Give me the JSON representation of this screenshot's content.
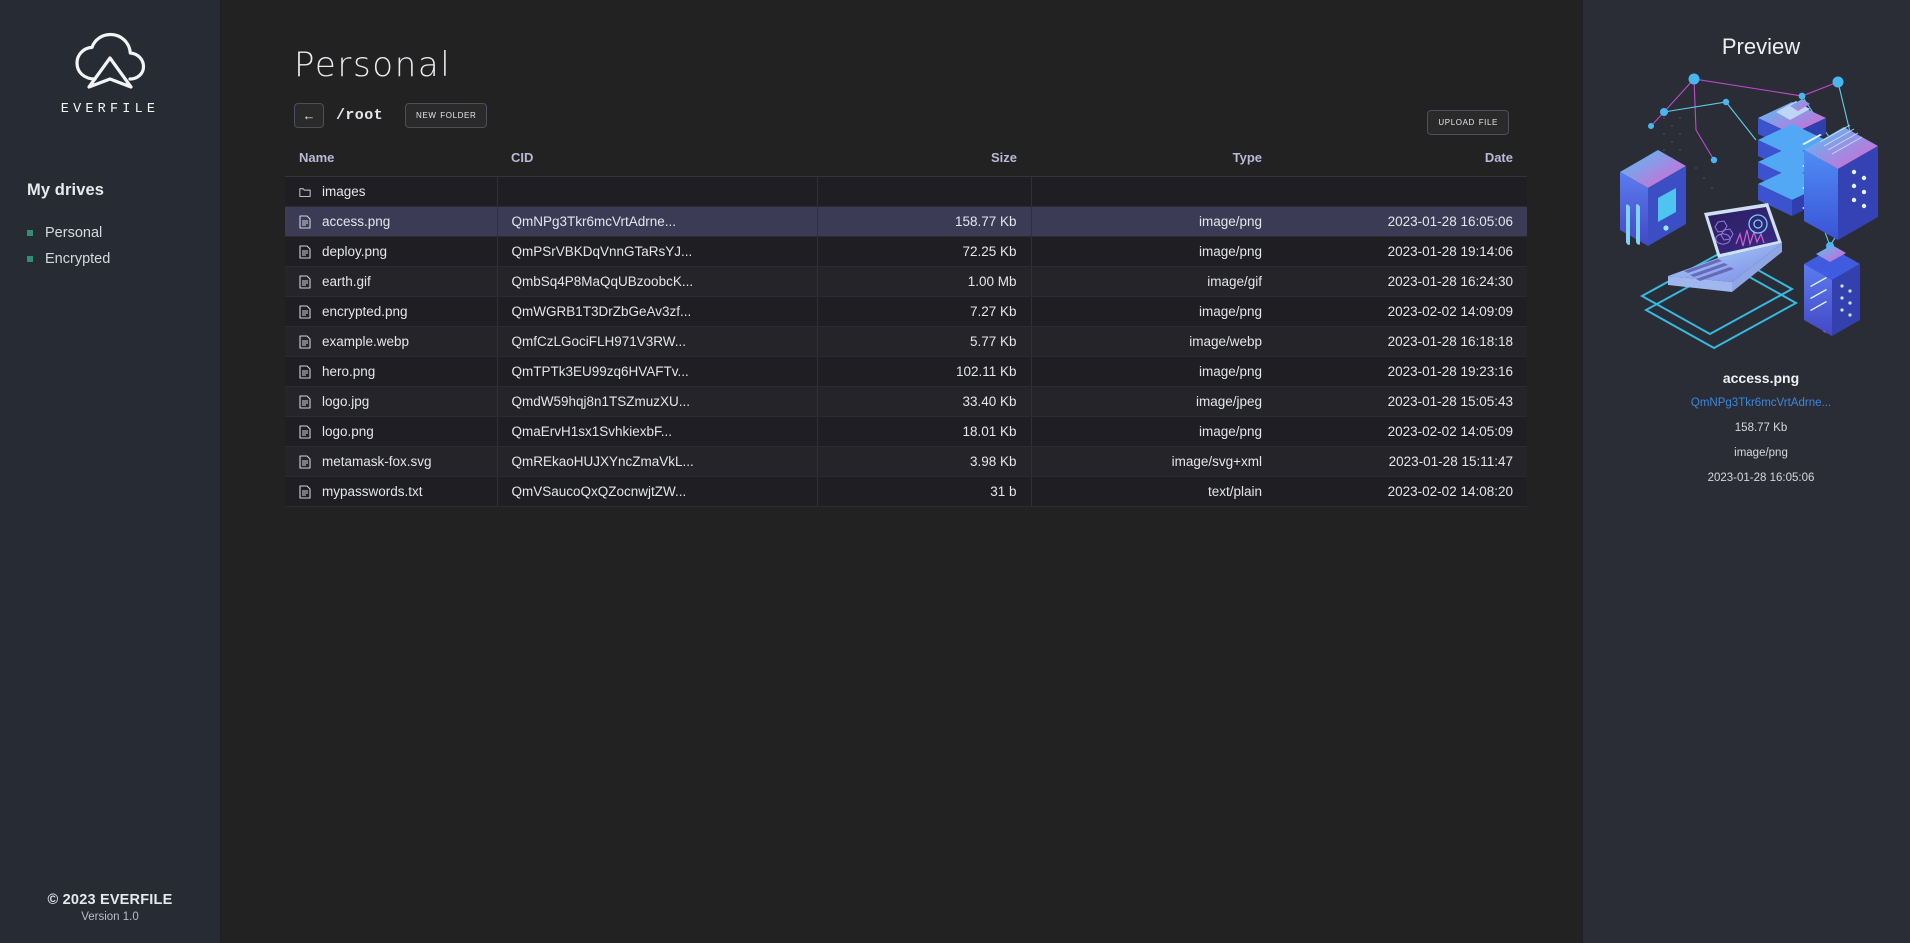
{
  "brand": {
    "name": "EVERFILE",
    "logo_icon": "cloud-upload-icon"
  },
  "sidebar": {
    "drives_heading": "My drives",
    "drives": [
      {
        "label": "Personal",
        "bullet_color": "#2f8f6f",
        "active": true
      },
      {
        "label": "Encrypted",
        "bullet_color": "#2f8f6f",
        "active": false
      }
    ],
    "footer": {
      "copyright": "© 2023 EVERFILE",
      "version": "Version 1.0"
    }
  },
  "main": {
    "page_title": "Personal",
    "toolbar": {
      "back_label": "←",
      "back_icon": "arrow-left-icon",
      "breadcrumb": "/root",
      "new_folder_label": "New Folder",
      "upload_label": "Upload File"
    },
    "table": {
      "columns": [
        "Name",
        "CID",
        "Size",
        "Type",
        "Date"
      ],
      "folders": [
        {
          "name": "images",
          "icon": "folder-icon"
        }
      ],
      "files": [
        {
          "name": "access.png",
          "icon": "file-icon",
          "cid": "QmNPg3Tkr6mcVrtAdrne...",
          "size": "158.77 Kb",
          "type": "image/png",
          "date": "2023-01-28 16:05:06",
          "selected": true
        },
        {
          "name": "deploy.png",
          "icon": "file-icon",
          "cid": "QmPSrVBKDqVnnGTaRsYJ...",
          "size": "72.25 Kb",
          "type": "image/png",
          "date": "2023-01-28 19:14:06",
          "selected": false
        },
        {
          "name": "earth.gif",
          "icon": "file-icon",
          "cid": "QmbSq4P8MaQqUBzoobcK...",
          "size": "1.00 Mb",
          "type": "image/gif",
          "date": "2023-01-28 16:24:30",
          "selected": false
        },
        {
          "name": "encrypted.png",
          "icon": "file-icon",
          "cid": "QmWGRB1T3DrZbGeAv3zf...",
          "size": "7.27 Kb",
          "type": "image/png",
          "date": "2023-02-02 14:09:09",
          "selected": false
        },
        {
          "name": "example.webp",
          "icon": "file-icon",
          "cid": "QmfCzLGociFLH971V3RW...",
          "size": "5.77 Kb",
          "type": "image/webp",
          "date": "2023-01-28 16:18:18",
          "selected": false
        },
        {
          "name": "hero.png",
          "icon": "file-icon",
          "cid": "QmTPTk3EU99zq6HVAFTv...",
          "size": "102.11 Kb",
          "type": "image/png",
          "date": "2023-01-28 19:23:16",
          "selected": false
        },
        {
          "name": "logo.jpg",
          "icon": "file-icon",
          "cid": "QmdW59hqj8n1TSZmuzXU...",
          "size": "33.40 Kb",
          "type": "image/jpeg",
          "date": "2023-01-28 15:05:43",
          "selected": false
        },
        {
          "name": "logo.png",
          "icon": "file-icon",
          "cid": "QmaErvH1sx1SvhkiexbF...",
          "size": "18.01 Kb",
          "type": "image/png",
          "date": "2023-02-02 14:05:09",
          "selected": false
        },
        {
          "name": "metamask-fox.svg",
          "icon": "file-icon",
          "cid": "QmREkaoHUJXYncZmaVkL...",
          "size": "3.98 Kb",
          "type": "image/svg+xml",
          "date": "2023-01-28 15:11:47",
          "selected": false
        },
        {
          "name": "mypasswords.txt",
          "icon": "file-icon",
          "cid": "QmVSaucoQxQZocnwjtZW...",
          "size": "31 b",
          "type": "text/plain",
          "date": "2023-02-02 14:08:20",
          "selected": false
        }
      ]
    }
  },
  "preview": {
    "title": "Preview",
    "illustration_icon": "isometric-datacenter-illustration",
    "file_name": "access.png",
    "cid": "QmNPg3Tkr6mcVrtAdrne...",
    "size": "158.77 Kb",
    "type": "image/png",
    "date": "2023-01-28 16:05:06",
    "cid_link_color": "#3c86dd"
  },
  "colors": {
    "sidebar_bg": "#272b33",
    "main_bg": "#222222",
    "panel_bg": "#2a2d35",
    "row_selected": "#3b3b55",
    "header_text": "#b9b9d8",
    "accent_green": "#2f8f6f"
  }
}
